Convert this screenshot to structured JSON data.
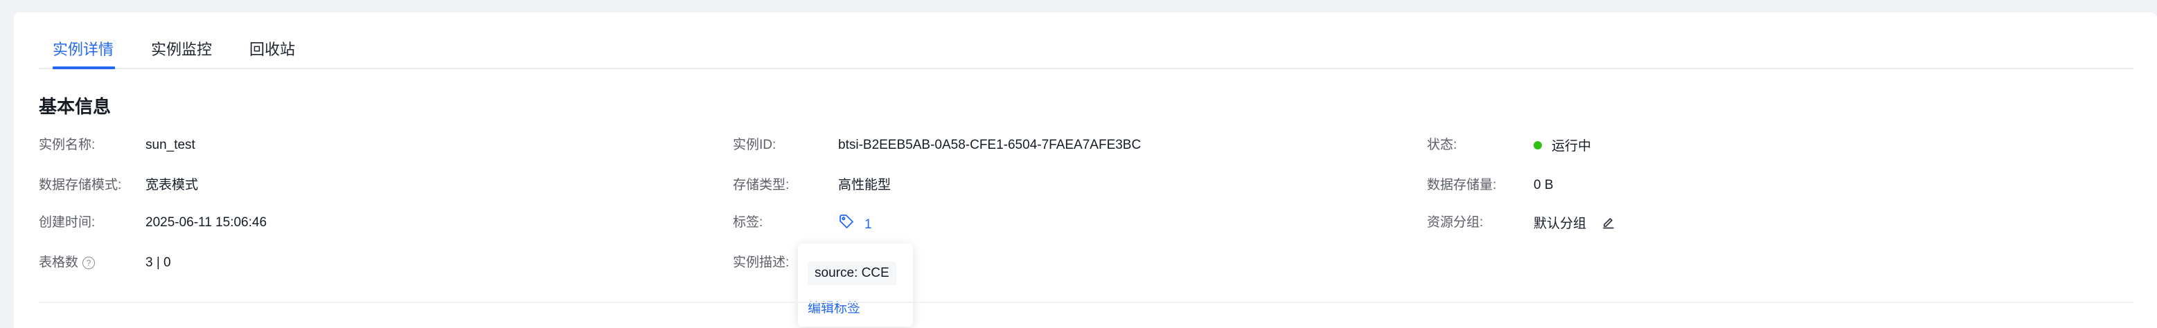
{
  "tabs": [
    {
      "label": "实例详情",
      "active": true
    },
    {
      "label": "实例监控",
      "active": false
    },
    {
      "label": "回收站",
      "active": false
    }
  ],
  "section_title": "基本信息",
  "fields": {
    "instance_name": {
      "label": "实例名称:",
      "value": "sun_test"
    },
    "instance_id": {
      "label": "实例ID:",
      "value": "btsi-B2EEB5AB-0A58-CFE1-6504-7FAEA7AFE3BC"
    },
    "status": {
      "label": "状态:",
      "value": "运行中",
      "color": "#30bf13"
    },
    "storage_mode": {
      "label": "数据存储模式:",
      "value": "宽表模式"
    },
    "storage_type": {
      "label": "存储类型:",
      "value": "高性能型"
    },
    "storage_amount": {
      "label": "数据存储量:",
      "value": "0 B"
    },
    "create_time": {
      "label": "创建时间:",
      "value": "2025-06-11 15:06:46"
    },
    "tags": {
      "label": "标签:",
      "count": "1"
    },
    "resource_group": {
      "label": "资源分组:",
      "value": "默认分组"
    },
    "table_count": {
      "label": "表格数",
      "value": "3 | 0"
    },
    "description": {
      "label": "实例描述:"
    }
  },
  "tag_popover": {
    "tag": "source: CCE",
    "edit_label": "编辑标签"
  },
  "icons": {
    "help": "question-circle-icon",
    "tag": "tag-icon",
    "edit": "pencil-icon"
  },
  "colors": {
    "accent": "#2468f2",
    "status_running": "#30bf13"
  }
}
